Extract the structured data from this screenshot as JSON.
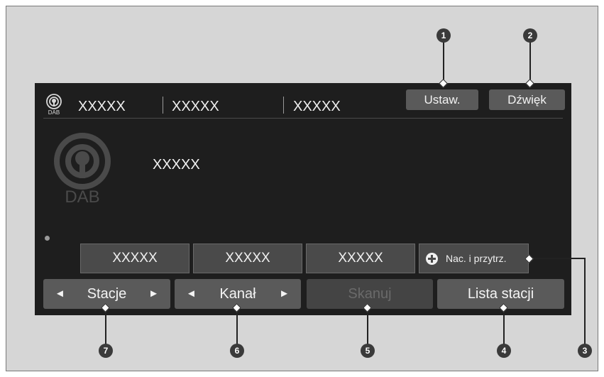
{
  "status_bar": {
    "band_icon_label": "DAB",
    "items": [
      "XXXXX",
      "XXXXX",
      "XXXXX"
    ],
    "settings_label": "Ustaw.",
    "sound_label": "Dźwięk"
  },
  "main": {
    "logo_label": "DAB",
    "station_name": "XXXXX"
  },
  "presets": [
    "XXXXX",
    "XXXXX",
    "XXXXX"
  ],
  "add_preset_label": "Nac. i przytrz.",
  "bottom": {
    "stations_label": "Stacje",
    "channel_label": "Kanał",
    "scan_label": "Skanuj",
    "station_list_label": "Lista stacji",
    "left_arrow": "◄",
    "right_arrow": "►"
  },
  "callouts": [
    "1",
    "2",
    "3",
    "4",
    "5",
    "6",
    "7"
  ]
}
